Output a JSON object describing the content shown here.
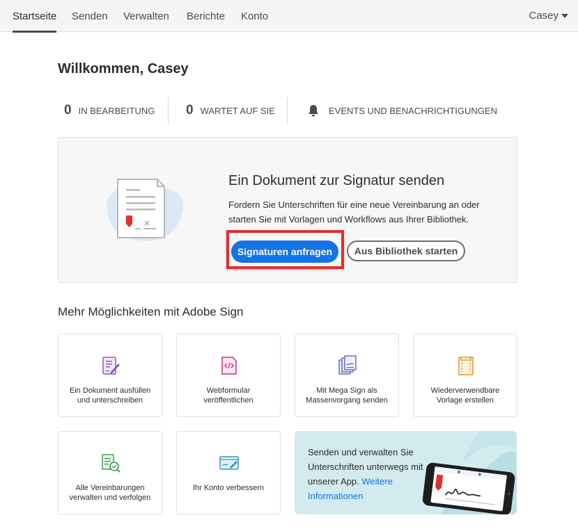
{
  "nav": {
    "items": [
      "Startseite",
      "Senden",
      "Verwalten",
      "Berichte",
      "Konto"
    ],
    "active": "Startseite",
    "user": "Casey"
  },
  "welcome": "Willkommen, Casey",
  "stats": {
    "in_progress": {
      "count": "0",
      "label": "IN BEARBEITUNG"
    },
    "waiting": {
      "count": "0",
      "label": "WARTET AUF SIE"
    },
    "events": {
      "label": "EVENTS UND BENACHRICHTIGUNGEN",
      "icon": "bell-icon"
    }
  },
  "hero": {
    "title": "Ein Dokument zur Signatur senden",
    "description": "Fordern Sie Unterschriften für eine neue Vereinbarung an oder starten Sie mit Vorlagen und Workflows aus Ihrer Bibliothek.",
    "primary_button": "Signaturen anfragen",
    "secondary_button": "Aus Bibliothek starten"
  },
  "more": {
    "title": "Mehr Möglichkeiten mit Adobe Sign",
    "tiles": [
      {
        "label": "Ein Dokument ausfüllen und unterschreiben",
        "icon": "fill-sign-icon",
        "color": "#8a5ab7"
      },
      {
        "label": "Webformular veröffentlichen",
        "icon": "web-form-icon",
        "color": "#c4337e"
      },
      {
        "label": "Mit Mega Sign als Massenvorgang senden",
        "icon": "mega-sign-icon",
        "color": "#5b6db6"
      },
      {
        "label": "Wiederverwendbare Vorlage erstellen",
        "icon": "template-icon",
        "color": "#e09a2c"
      },
      {
        "label": "Alle Vereinbarungen verwalten und verfolgen",
        "icon": "manage-agreements-icon",
        "color": "#3f9a52"
      },
      {
        "label": "Ihr Konto verbessern",
        "icon": "account-upgrade-icon",
        "color": "#2f9ab5"
      }
    ],
    "promo": {
      "text": "Senden und verwalten Sie Unterschriften unterwegs mit unserer App.",
      "link": "Weitere Informationen"
    }
  },
  "colors": {
    "accent": "#1473e6",
    "highlight": "#e52b2b",
    "nav_bg": "#f5f5f5",
    "promo_bg": "#d3ebef"
  }
}
